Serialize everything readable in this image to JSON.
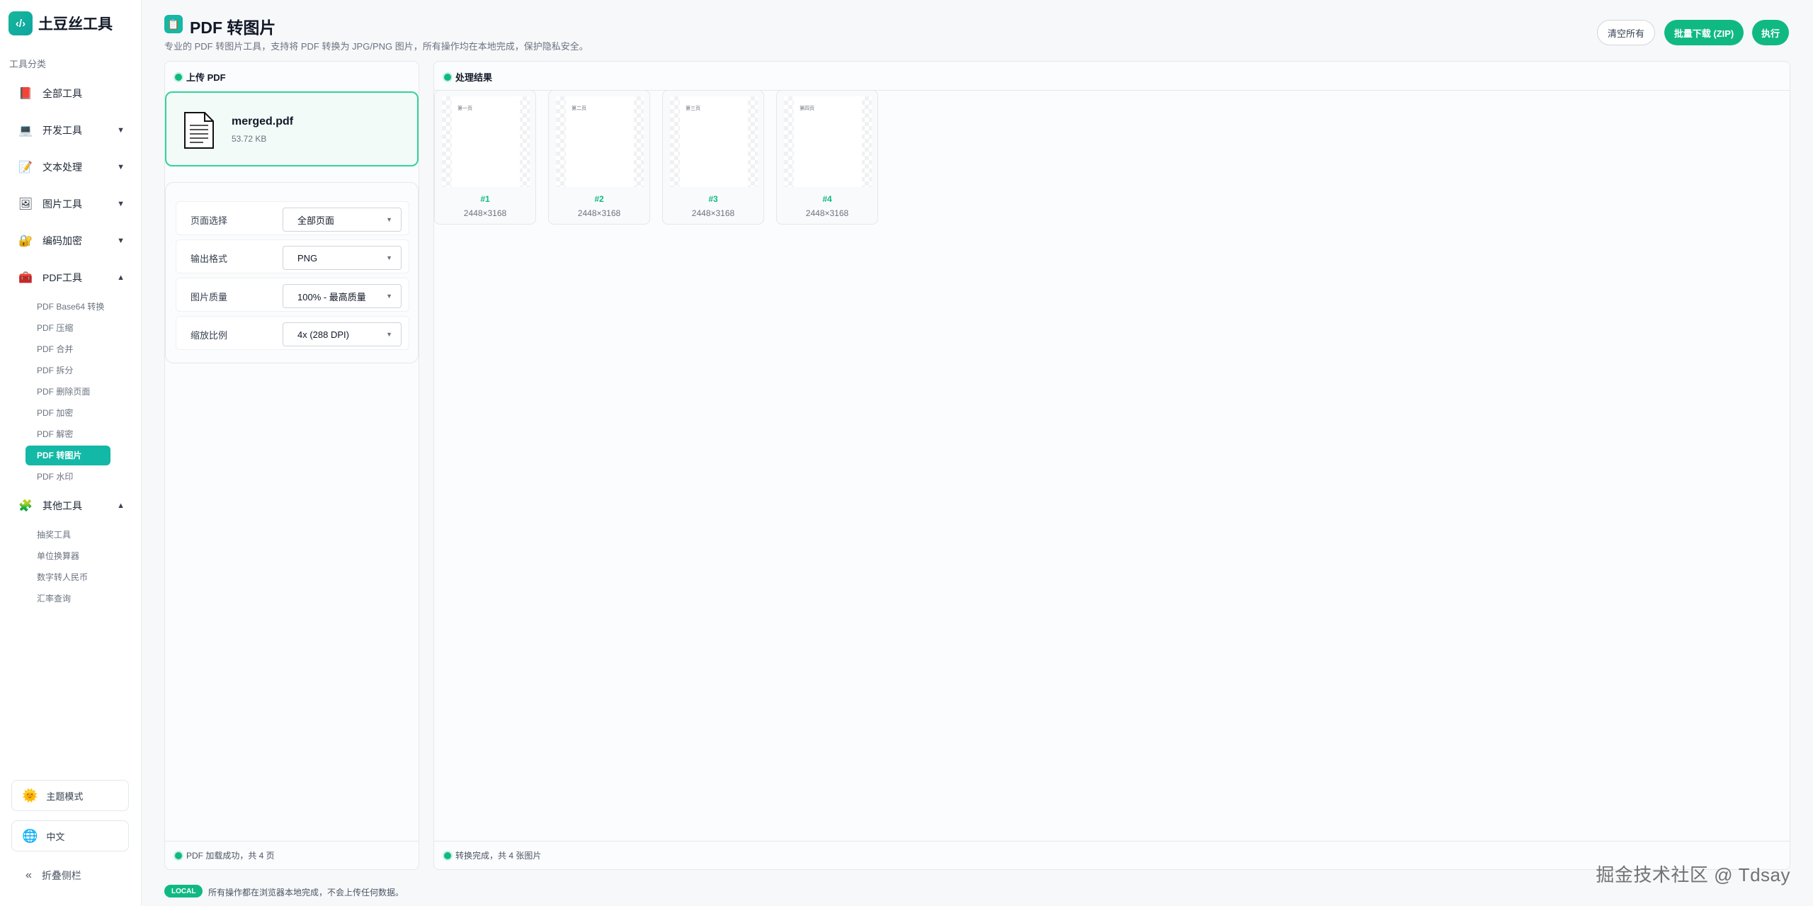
{
  "brand": {
    "logo": "‹/›",
    "name": "土豆丝工具"
  },
  "sidebar": {
    "section_label": "工具分类",
    "items": [
      {
        "label": "全部工具",
        "icon": "book-icon",
        "glyph": "📕",
        "chevron": ""
      },
      {
        "label": "开发工具",
        "icon": "laptop-icon",
        "glyph": "💻",
        "chevron": "▼"
      },
      {
        "label": "文本处理",
        "icon": "memo-icon",
        "glyph": "📝",
        "chevron": "▼"
      },
      {
        "label": "图片工具",
        "icon": "picture-icon",
        "glyph": "🖼",
        "chevron": "▼"
      },
      {
        "label": "编码加密",
        "icon": "lock-icon",
        "glyph": "🔐",
        "chevron": "▼"
      },
      {
        "label": "PDF工具",
        "icon": "toolbox-icon",
        "glyph": "🧰",
        "chevron": "▲"
      },
      {
        "label": "其他工具",
        "icon": "puzzle-icon",
        "glyph": "🧩",
        "chevron": "▲"
      }
    ],
    "pdf_sub": [
      "PDF Base64 转换",
      "PDF 压缩",
      "PDF 合并",
      "PDF 拆分",
      "PDF 删除页面",
      "PDF 加密",
      "PDF 解密",
      "PDF 转图片",
      "PDF 水印"
    ],
    "pdf_active": "PDF 转图片",
    "other_sub": [
      "抽奖工具",
      "单位换算器",
      "数字转人民币",
      "汇率查询"
    ],
    "theme_label": "主题模式",
    "lang_label": "中文",
    "collapse_label": "折叠侧栏"
  },
  "header": {
    "title": "PDF 转图片",
    "description": "专业的 PDF 转图片工具，支持将 PDF 转换为 JPG/PNG 图片，所有操作均在本地完成，保护隐私安全。",
    "clear_label": "清空所有",
    "zip_label": "批量下载 (ZIP)",
    "run_label": "执行"
  },
  "upload_panel": {
    "title": "上传 PDF",
    "file_name": "merged.pdf",
    "file_size": "53.72 KB",
    "status": "PDF 加载成功，共 4 页"
  },
  "options": [
    {
      "label": "页面选择",
      "value": "全部页面"
    },
    {
      "label": "输出格式",
      "value": "PNG"
    },
    {
      "label": "图片质量",
      "value": "100% - 最高质量"
    },
    {
      "label": "缩放比例",
      "value": "4x (288 DPI)"
    }
  ],
  "results_panel": {
    "title": "处理结果",
    "status": "转换完成，共 4 张图片",
    "images": [
      {
        "number": "#1",
        "size": "2448×3168",
        "page_text": "第一页"
      },
      {
        "number": "#2",
        "size": "2448×3168",
        "page_text": "第二页"
      },
      {
        "number": "#3",
        "size": "2448×3168",
        "page_text": "第三页"
      },
      {
        "number": "#4",
        "size": "2448×3168",
        "page_text": "第四页"
      }
    ]
  },
  "footer": {
    "badge": "LOCAL",
    "note": "所有操作都在浏览器本地完成，不会上传任何数据。",
    "watermark": "掘金技术社区 @ Tdsay"
  },
  "colors": {
    "accent": "#10b981",
    "active": "#14b8a6",
    "border": "#e5e7eb"
  }
}
